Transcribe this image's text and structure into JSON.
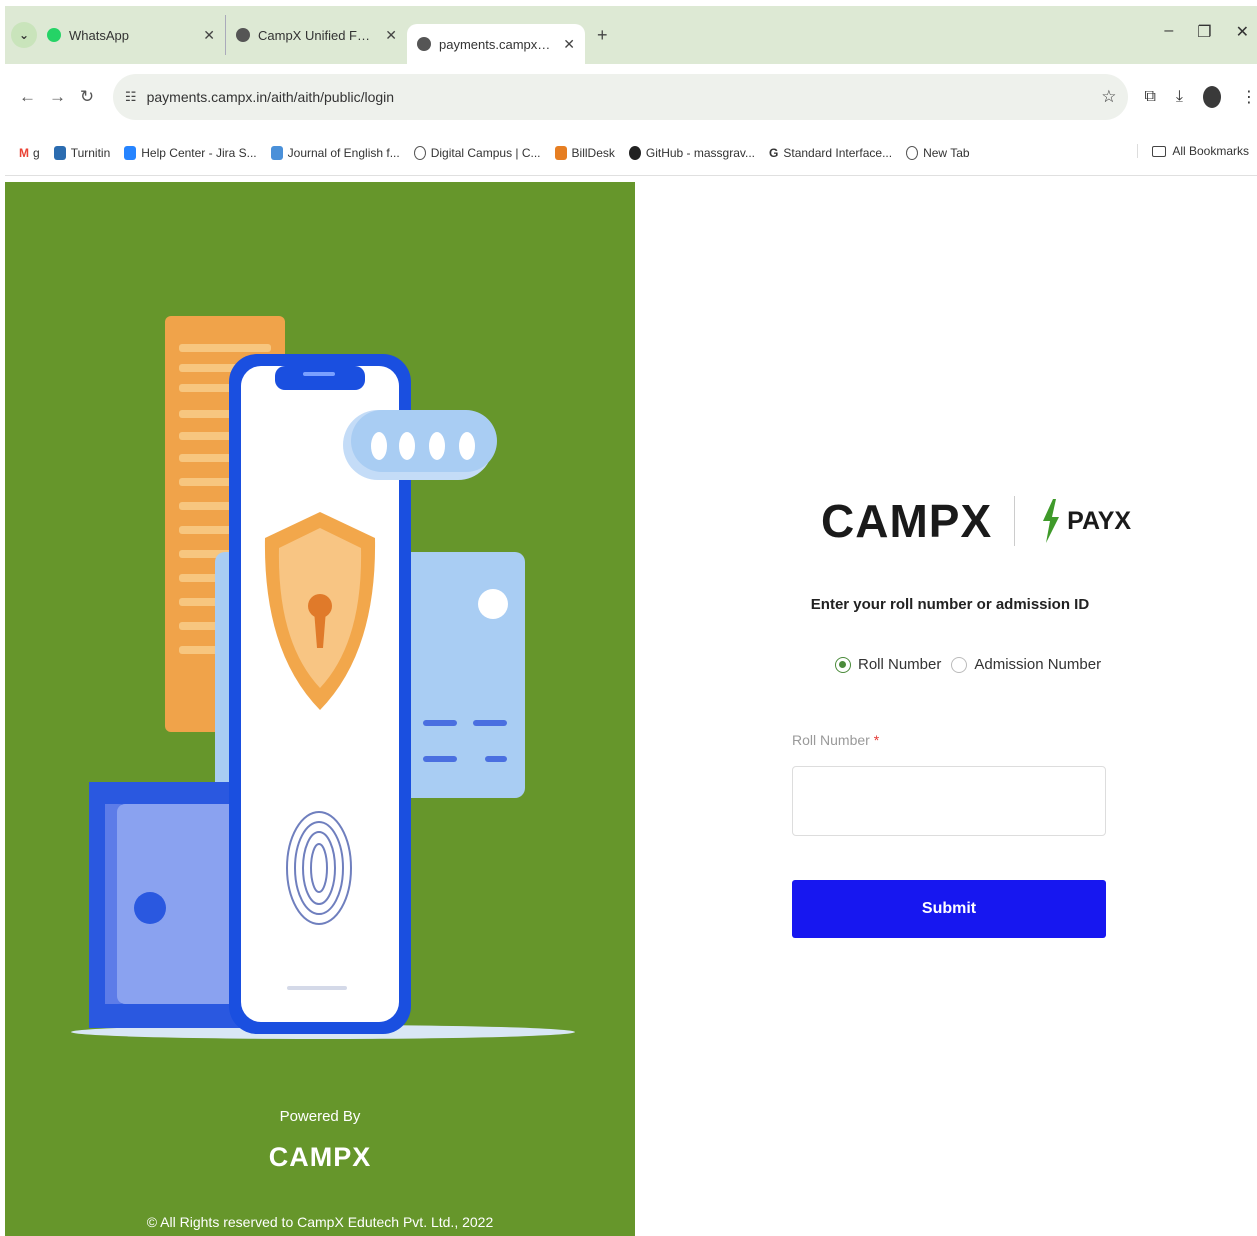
{
  "browser": {
    "tabs": [
      {
        "title": "WhatsApp",
        "favicon_color": "#25d366"
      },
      {
        "title": "CampX Unified Fee Payments",
        "favicon_color": "#555555"
      },
      {
        "title": "payments.campx.in/aith/aith/p",
        "favicon_color": "#555555",
        "active": true
      }
    ],
    "url": "payments.campx.in/aith/aith/public/login",
    "bookmarks": [
      {
        "label": "g",
        "color": "#ea4335"
      },
      {
        "label": "Turnitin",
        "color": "#2b6cb0"
      },
      {
        "label": "Help Center - Jira S...",
        "color": "#2684ff"
      },
      {
        "label": "Journal of English f...",
        "color": "#4a90d9"
      },
      {
        "label": "Digital Campus | C...",
        "color": "#555555"
      },
      {
        "label": "BillDesk",
        "color": "#e67e22"
      },
      {
        "label": "GitHub - massgrav...",
        "color": "#222222"
      },
      {
        "label": "Standard Interface...",
        "color": "#333333"
      },
      {
        "label": "New Tab",
        "color": "#555555"
      }
    ],
    "all_bookmarks": "All Bookmarks"
  },
  "left_panel": {
    "powered_by": "Powered By",
    "brand": "CAMPX",
    "copyright": "© All Rights reserved to CampX Edutech Pvt. Ltd., 2022"
  },
  "login": {
    "logo_left": "CAMPX",
    "logo_right": "PAYX",
    "prompt": "Enter your roll number or admission ID",
    "radio_roll": "Roll Number",
    "radio_admission": "Admission Number",
    "selected": "roll",
    "field_label": "Roll Number",
    "field_required": "*",
    "field_value": "",
    "submit": "Submit"
  },
  "colors": {
    "panel_green": "#66962b",
    "button_blue": "#1717f0",
    "radio_green": "#4b8b3b"
  }
}
